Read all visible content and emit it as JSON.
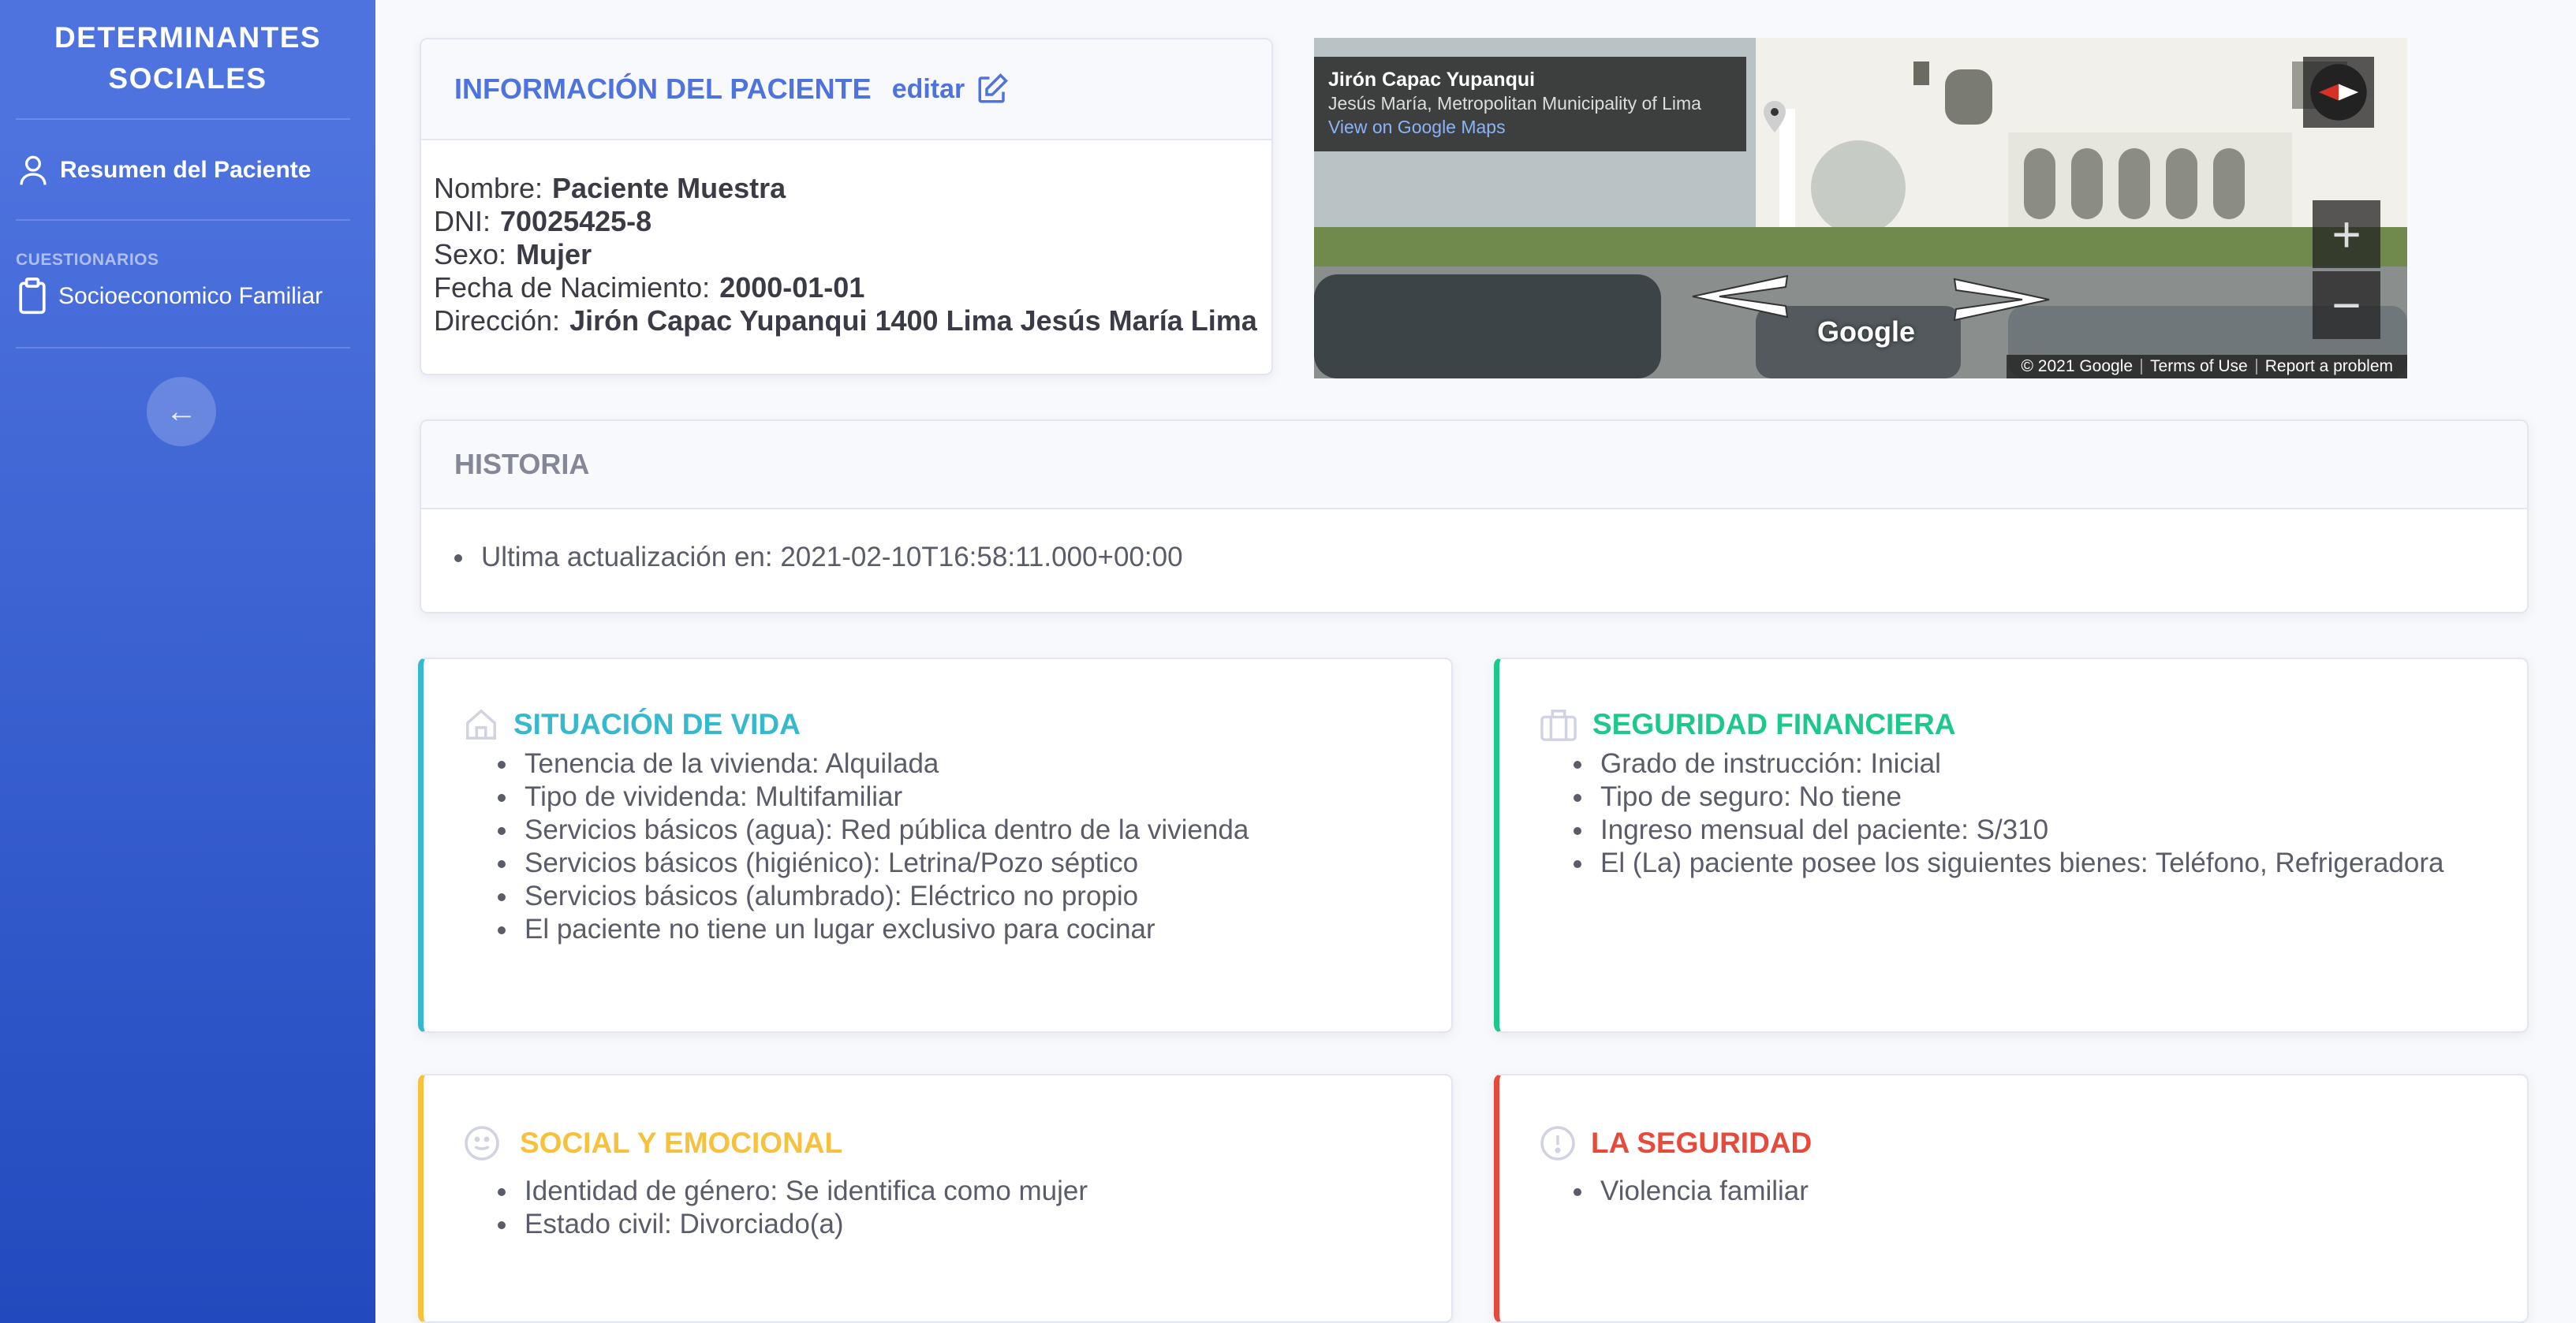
{
  "sidebar": {
    "brand_line1": "DETERMINANTES",
    "brand_line2": "SOCIALES",
    "nav_summary_label": "Resumen del Paciente",
    "section_heading": "CUESTIONARIOS",
    "nav_questionnaire_label": "Socioeconomico Familiar",
    "toggle_glyph": "←"
  },
  "patient": {
    "title": "INFORMACIÓN DEL PACIENTE",
    "edit_label": "editar",
    "fields": {
      "name_label": "Nombre:",
      "name_value": "Paciente Muestra",
      "dni_label": "DNI:",
      "dni_value": "70025425-8",
      "sex_label": "Sexo:",
      "sex_value": "Mujer",
      "dob_label": "Fecha de Nacimiento:",
      "dob_value": "2000-01-01",
      "address_label": "Dirección:",
      "address_value": "Jirón Capac Yupanqui 1400 Lima Jesús María Lima"
    }
  },
  "map": {
    "street": "Jirón Capac Yupanqui",
    "locality": "Jesús María, Metropolitan Municipality of Lima",
    "view_link": "View on Google Maps",
    "brand": "Google",
    "copyright": "© 2021 Google",
    "terms": "Terms of Use",
    "report": "Report a problem",
    "zoom_in": "+",
    "zoom_out": "−"
  },
  "history": {
    "title": "HISTORIA",
    "items": [
      "Ultima actualización en: 2021-02-10T16:58:11.000+00:00"
    ]
  },
  "living": {
    "title": "SITUACIÓN DE VIDA",
    "color": "#36b9cc",
    "items": [
      "Tenencia de la vivienda: Alquilada",
      "Tipo de vividenda: Multifamiliar",
      "Servicios básicos (agua): Red pública dentro de la vivienda",
      "Servicios básicos (higiénico): Letrina/Pozo séptico",
      "Servicios básicos (alumbrado): Eléctrico no propio",
      "El paciente no tiene un lugar exclusivo para cocinar"
    ]
  },
  "financial": {
    "title": "SEGURIDAD FINANCIERA",
    "color": "#1cc88a",
    "items": [
      "Grado de instrucción: Inicial",
      "Tipo de seguro: No tiene",
      "Ingreso mensual del paciente: S/310",
      "El (La) paciente posee los siguientes bienes: Teléfono, Refrigeradora"
    ]
  },
  "social": {
    "title": "SOCIAL Y EMOCIONAL",
    "color": "#f6c23e",
    "items": [
      "Identidad de género: Se identifica como mujer",
      "Estado civil: Divorciado(a)"
    ]
  },
  "security": {
    "title": "LA SEGURIDAD",
    "color": "#e74a3b",
    "items": [
      "Violencia familiar"
    ]
  }
}
